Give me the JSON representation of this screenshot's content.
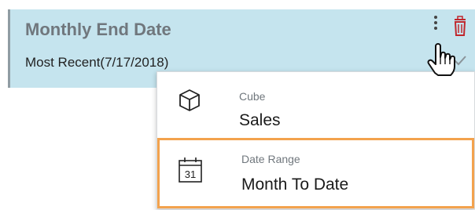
{
  "filter": {
    "title": "Monthly End Date",
    "value": "Most Recent(7/17/2018)"
  },
  "icons": {
    "more": "kebab-icon",
    "delete": "trash-icon",
    "cursor": "hand-pointer-icon",
    "confirm": "check-icon",
    "cube": "cube-icon",
    "calendar": "calendar-icon"
  },
  "menu": {
    "items": [
      {
        "sublabel": "Cube",
        "label": "Sales",
        "icon": "cube-icon"
      },
      {
        "sublabel": "Date Range",
        "label": "Month To Date",
        "icon": "calendar-icon",
        "calendar_day": "31",
        "highlighted": true
      }
    ]
  },
  "colors": {
    "card_background": "#c5e4ee",
    "highlight_border": "#f3a24d",
    "delete_red": "#c0272d"
  }
}
